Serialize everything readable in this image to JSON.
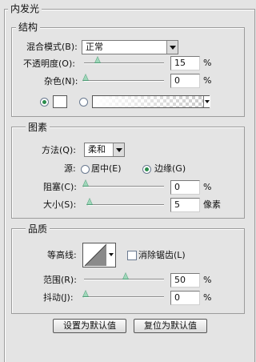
{
  "inner_glow": {
    "title": "内发光"
  },
  "structure": {
    "title": "结构",
    "blend_mode_label": "混合模式(B):",
    "blend_mode_value": "正常",
    "opacity_label": "不透明度(O):",
    "opacity_value": "15",
    "opacity_unit": "%",
    "opacity_level": 15,
    "noise_label": "杂色(N):",
    "noise_value": "0",
    "noise_unit": "%",
    "noise_level": 0,
    "color_swatch": "#ffffff"
  },
  "elements": {
    "title": "图素",
    "method_label": "方法(Q):",
    "method_value": "柔和",
    "source_label": "源:",
    "source_center_label": "居中(E)",
    "source_edge_label": "边缘(G)",
    "choke_label": "阻塞(C):",
    "choke_value": "0",
    "choke_unit": "%",
    "choke_level": 0,
    "size_label": "大小(S):",
    "size_value": "5",
    "size_unit": "像素"
  },
  "quality": {
    "title": "品质",
    "contour_label": "等高线:",
    "antialias_label": "消除锯齿(L)",
    "antialias_checked": false,
    "range_label": "范围(R):",
    "range_value": "50",
    "range_unit": "%",
    "range_level": 50,
    "jitter_label": "抖动(J):",
    "jitter_value": "0",
    "jitter_unit": "%",
    "jitter_level": 0
  },
  "buttons": {
    "make_default": "设置为默认值",
    "reset_default": "复位为默认值"
  }
}
